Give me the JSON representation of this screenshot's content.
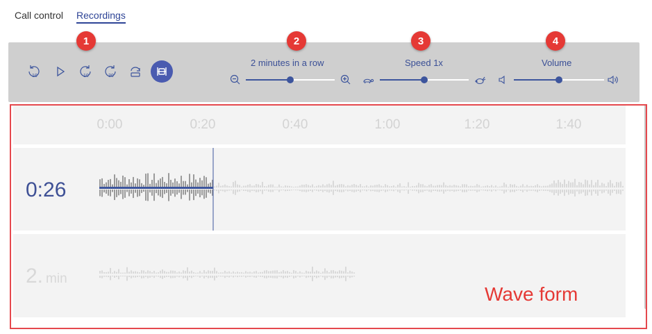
{
  "tabs": [
    {
      "label": "Call control"
    },
    {
      "label": "Recordings",
      "active": true
    }
  ],
  "badges": [
    "1",
    "2",
    "3",
    "4"
  ],
  "controls": {
    "buttons": [
      {
        "name": "rewind-10-icon"
      },
      {
        "name": "play-icon"
      },
      {
        "name": "forward-10-icon"
      },
      {
        "name": "forward-30-icon"
      },
      {
        "name": "loop-icon"
      },
      {
        "name": "fit-view-icon",
        "active": true
      }
    ],
    "zoom": {
      "label": "2 minutes in a row",
      "value": 0.5,
      "min_icon": "zoom-out-icon",
      "max_icon": "zoom-in-icon"
    },
    "speed": {
      "label": "Speed 1x",
      "value": 0.5,
      "min_icon": "turtle-icon",
      "max_icon": "rabbit-icon"
    },
    "volume": {
      "label": "Volume",
      "value": 0.5,
      "min_icon": "volume-low-icon",
      "max_icon": "volume-high-icon"
    }
  },
  "timeline": {
    "ticks": [
      "0:00",
      "0:20",
      "0:40",
      "1:00",
      "1:20",
      "1:40"
    ]
  },
  "tracks": [
    {
      "time": "0:26",
      "unit": "",
      "progress": 0.26
    },
    {
      "time": "2.",
      "unit": "min",
      "progress": 0
    }
  ],
  "annotation": {
    "label": "Wave form",
    "color": "#e53935"
  },
  "colors": {
    "accent": "#3d559d",
    "highlight": "#e53935"
  }
}
